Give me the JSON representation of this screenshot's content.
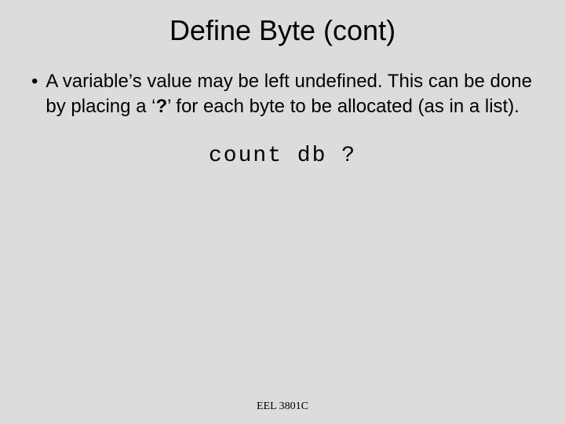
{
  "title": "Define Byte (cont)",
  "bullet": {
    "pre": "A variable’s value may be left undefined. This can be done by placing a ‘",
    "bold": "?",
    "post": "’ for each byte to be allocated (as in a list)."
  },
  "code": "count db ?",
  "footer": "EEL 3801C"
}
